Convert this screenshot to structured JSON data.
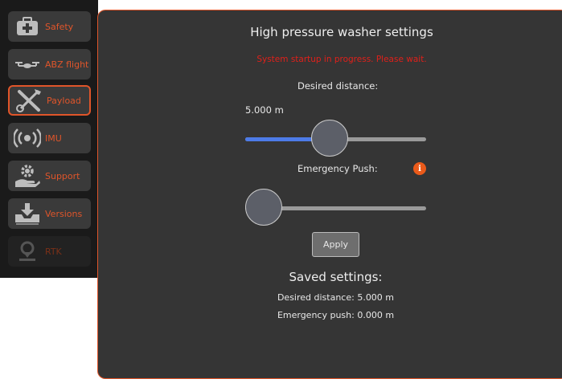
{
  "sidebar": {
    "items": [
      {
        "label": "Safety",
        "icon": "first-aid-kit-icon",
        "active": false,
        "disabled": false
      },
      {
        "label": "ABZ flight",
        "icon": "drone-icon",
        "active": false,
        "disabled": false
      },
      {
        "label": "Payload",
        "icon": "tools-icon",
        "active": true,
        "disabled": false
      },
      {
        "label": "IMU",
        "icon": "broadcast-icon",
        "active": false,
        "disabled": false
      },
      {
        "label": "Support",
        "icon": "gear-hand-icon",
        "active": false,
        "disabled": false
      },
      {
        "label": "Versions",
        "icon": "download-tray-icon",
        "active": false,
        "disabled": false
      },
      {
        "label": "RTK",
        "icon": "location-pin-icon",
        "active": false,
        "disabled": true
      }
    ]
  },
  "panel": {
    "title": "High pressure washer settings",
    "status": "System startup in progress. Please wait.",
    "desired_distance_label": "Desired distance:",
    "desired_distance_value": "5.000 m",
    "desired_distance_slider_fraction": 0.46,
    "emergency_push_label": "Emergency Push:",
    "emergency_push_slider_fraction": 0.0,
    "info_icon_glyph": "i",
    "apply_label": "Apply",
    "saved_title": "Saved settings:",
    "saved_desired_distance": "Desired distance:  5.000 m",
    "saved_emergency_push": "Emergency push:  0.000 m"
  },
  "colors": {
    "accent": "#e0552a",
    "slider_fill": "#4d7be8",
    "status_red": "#e0201a"
  }
}
